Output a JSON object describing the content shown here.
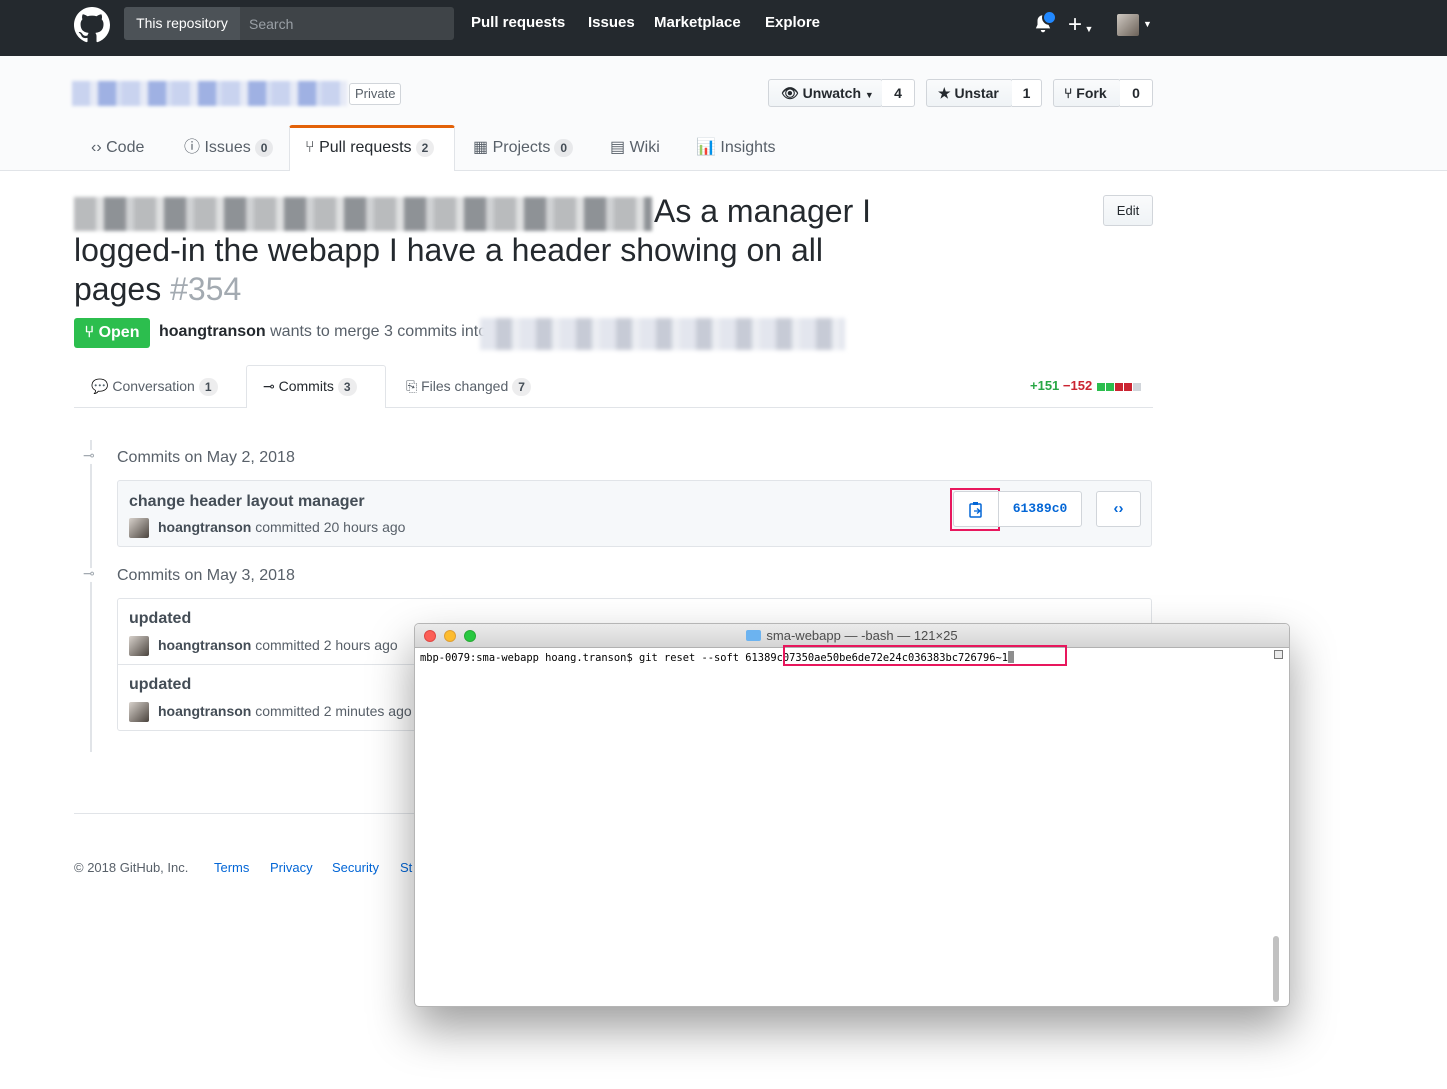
{
  "header": {
    "search_scope": "This repository",
    "search_placeholder": "Search",
    "nav": [
      "Pull requests",
      "Issues",
      "Marketplace",
      "Explore"
    ]
  },
  "repo": {
    "visibility": "Private",
    "watch": {
      "label": "Unwatch",
      "count": "4"
    },
    "star": {
      "label": "Unstar",
      "count": "1"
    },
    "fork": {
      "label": "Fork",
      "count": "0"
    },
    "tabs": [
      {
        "label": "Code"
      },
      {
        "label": "Issues",
        "count": "0"
      },
      {
        "label": "Pull requests",
        "count": "2"
      },
      {
        "label": "Projects",
        "count": "0"
      },
      {
        "label": "Wiki"
      },
      {
        "label": "Insights"
      }
    ]
  },
  "pr": {
    "title_visible": "As a manager I logged-in the webapp I have a header showing on all pages",
    "number": "#354",
    "edit_label": "Edit",
    "state": "Open",
    "author": "hoangtranson",
    "merge_text": "wants to merge 3 commits into",
    "tabs": [
      {
        "label": "Conversation",
        "count": "1"
      },
      {
        "label": "Commits",
        "count": "3"
      },
      {
        "label": "Files changed",
        "count": "7"
      }
    ],
    "additions": "+151",
    "deletions": "−152"
  },
  "commit_groups": [
    {
      "date": "Commits on May 2, 2018",
      "commits": [
        {
          "title": "change header layout manager",
          "author": "hoangtranson",
          "time": "committed 20 hours ago",
          "sha": "61389c0"
        }
      ]
    },
    {
      "date": "Commits on May 3, 2018",
      "commits": [
        {
          "title": "updated",
          "author": "hoangtranson",
          "time": "committed 2 hours ago"
        },
        {
          "title": "updated",
          "author": "hoangtranson",
          "time": "committed 2 minutes ago"
        }
      ]
    }
  ],
  "footer": {
    "copyright": "© 2018 GitHub, Inc.",
    "links": [
      "Terms",
      "Privacy",
      "Security",
      "St"
    ]
  },
  "terminal": {
    "title": "sma-webapp — -bash — 121×25",
    "prompt": "mbp-0079:sma-webapp hoang.transon$ git reset --soft ",
    "hash": "61389c07350ae50be6de72e24c036383bc726796",
    "suffix": "~1"
  },
  "colors": {
    "header_bg": "#24292e",
    "open_green": "#2cbe4e",
    "link_blue": "#0366d6",
    "highlight_pink": "#e8175d",
    "tab_accent": "#e36209"
  }
}
